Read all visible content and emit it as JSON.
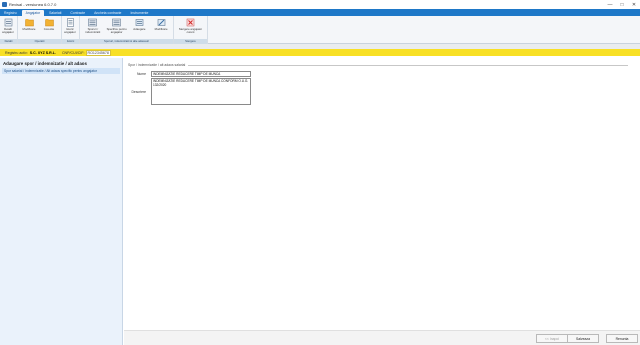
{
  "window": {
    "title": "Revisal - versiunea 6.0.7.0",
    "controls": [
      "—",
      "□",
      "✕"
    ]
  },
  "tabs": [
    {
      "label": "Registru",
      "active": false
    },
    {
      "label": "Angajator",
      "active": true
    },
    {
      "label": "Salariati",
      "active": false
    },
    {
      "label": "Contracte",
      "active": false
    },
    {
      "label": "Ancheta contracte",
      "active": false
    },
    {
      "label": "Instrumente",
      "active": false
    }
  ],
  "ribbon": {
    "groups": [
      {
        "name": "Detalii",
        "buttons": [
          {
            "label": "Detalii angajator",
            "icon": "details-icon"
          }
        ]
      },
      {
        "name": "Operatii",
        "buttons": [
          {
            "label": "Modificare",
            "icon": "edit-folder-icon"
          },
          {
            "label": "Corectie",
            "icon": "correction-folder-icon"
          }
        ]
      },
      {
        "name": "Istoric",
        "buttons": [
          {
            "label": "Istoric angajator",
            "icon": "history-icon"
          }
        ]
      },
      {
        "name": "Sporuri, indemnizatii si alte adaosuri",
        "buttons": [
          {
            "label": "Sporuri / indemnizatii",
            "icon": "allowance-list-icon"
          },
          {
            "label": "Specifice pentru angajator",
            "icon": "specific-list-icon"
          },
          {
            "label": "Adaugare",
            "icon": "add-icon"
          },
          {
            "label": "Modificare",
            "icon": "modify-icon"
          }
        ]
      },
      {
        "name": "Stergere",
        "buttons": [
          {
            "label": "Stergere angajator curent",
            "icon": "delete-icon"
          }
        ]
      }
    ]
  },
  "context_bar": {
    "employer_label": "Registru activ:",
    "employer_name": "S.C. XYZ S.R.L.",
    "period_label": "CNP/CUI/CIF:",
    "period_value": "RO12345678"
  },
  "left_panel": {
    "title": "Adaugare spor / indemnizatie / alt adaos",
    "items": [
      "Spor salarial / Indemnizatie / Alt adaos specific pentru angajator"
    ]
  },
  "form": {
    "section_title": "Spor / indemnizatie / alt adaos salarial",
    "name_label": "Nume",
    "name_value": "INDEMNIZATIE REDUCERE TIMP DE MUNCA",
    "description_label": "Descriere",
    "description_value": "INDEMNIZATIE REDUCERE TIMP DE MUNCA CONFORM O.U.G. 132/2020"
  },
  "footer": {
    "back_label": "<< Inapoi",
    "save_label": "Salveaza",
    "cancel_label": "Renunta"
  },
  "colors": {
    "tab_bar": "#1e78c8",
    "context_bar": "#f8e026",
    "left_panel": "#eaf2fb"
  }
}
